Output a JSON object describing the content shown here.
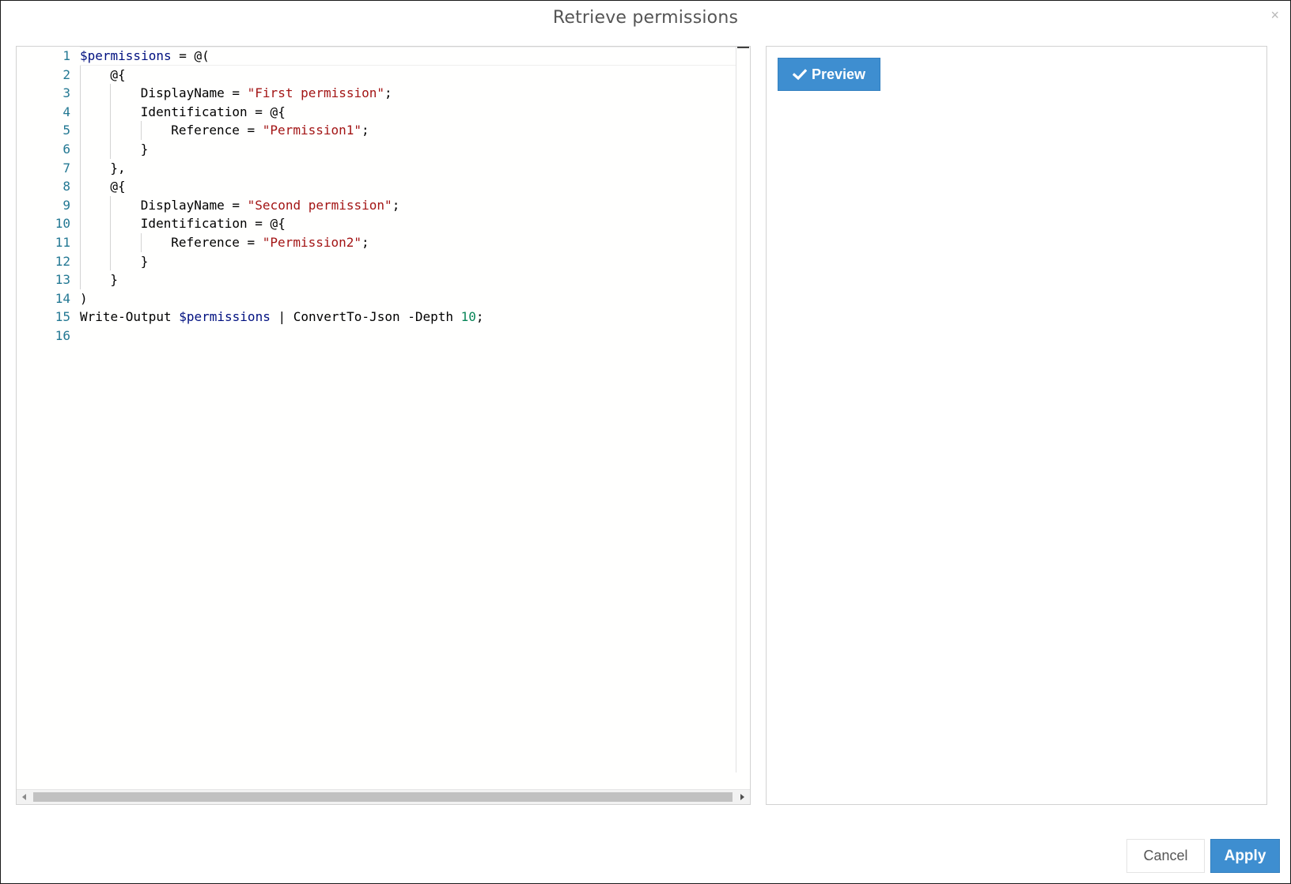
{
  "dialog": {
    "title": "Retrieve permissions",
    "close_icon": "close-icon",
    "close_glyph": "×"
  },
  "editor": {
    "language": "powershell",
    "colors": {
      "line_number": "#237893",
      "variable": "#001080",
      "string": "#a31515",
      "number": "#098658",
      "text": "#000000"
    },
    "lines": [
      {
        "n": "1",
        "indent": 0,
        "tokens": [
          {
            "t": "var",
            "v": "$permissions"
          },
          {
            "t": "op",
            "v": " = @("
          }
        ]
      },
      {
        "n": "2",
        "indent": 1,
        "tokens": [
          {
            "t": "op",
            "v": "@{"
          }
        ]
      },
      {
        "n": "3",
        "indent": 2,
        "tokens": [
          {
            "t": "op",
            "v": "DisplayName = "
          },
          {
            "t": "str",
            "v": "\"First permission\""
          },
          {
            "t": "op",
            "v": ";"
          }
        ]
      },
      {
        "n": "4",
        "indent": 2,
        "tokens": [
          {
            "t": "op",
            "v": "Identification = @{"
          }
        ]
      },
      {
        "n": "5",
        "indent": 3,
        "tokens": [
          {
            "t": "op",
            "v": "Reference = "
          },
          {
            "t": "str",
            "v": "\"Permission1\""
          },
          {
            "t": "op",
            "v": ";"
          }
        ]
      },
      {
        "n": "6",
        "indent": 2,
        "tokens": [
          {
            "t": "op",
            "v": "}"
          }
        ]
      },
      {
        "n": "7",
        "indent": 1,
        "tokens": [
          {
            "t": "op",
            "v": "},"
          }
        ]
      },
      {
        "n": "8",
        "indent": 1,
        "tokens": [
          {
            "t": "op",
            "v": "@{"
          }
        ]
      },
      {
        "n": "9",
        "indent": 2,
        "tokens": [
          {
            "t": "op",
            "v": "DisplayName = "
          },
          {
            "t": "str",
            "v": "\"Second permission\""
          },
          {
            "t": "op",
            "v": ";"
          }
        ]
      },
      {
        "n": "10",
        "indent": 2,
        "tokens": [
          {
            "t": "op",
            "v": "Identification = @{"
          }
        ]
      },
      {
        "n": "11",
        "indent": 3,
        "tokens": [
          {
            "t": "op",
            "v": "Reference = "
          },
          {
            "t": "str",
            "v": "\"Permission2\""
          },
          {
            "t": "op",
            "v": ";"
          }
        ]
      },
      {
        "n": "12",
        "indent": 2,
        "tokens": [
          {
            "t": "op",
            "v": "}"
          }
        ]
      },
      {
        "n": "13",
        "indent": 1,
        "tokens": [
          {
            "t": "op",
            "v": "}"
          }
        ]
      },
      {
        "n": "14",
        "indent": 0,
        "tokens": [
          {
            "t": "op",
            "v": ")"
          }
        ]
      },
      {
        "n": "15",
        "indent": 0,
        "tokens": [
          {
            "t": "op",
            "v": "Write-Output "
          },
          {
            "t": "var",
            "v": "$permissions"
          },
          {
            "t": "op",
            "v": " | ConvertTo-Json -Depth "
          },
          {
            "t": "num",
            "v": "10"
          },
          {
            "t": "op",
            "v": ";"
          }
        ]
      },
      {
        "n": "16",
        "indent": 0,
        "tokens": []
      }
    ]
  },
  "preview": {
    "button_label": "Preview",
    "button_icon": "check-icon",
    "accent": "#3e8ed0"
  },
  "footer": {
    "cancel_label": "Cancel",
    "apply_label": "Apply"
  }
}
